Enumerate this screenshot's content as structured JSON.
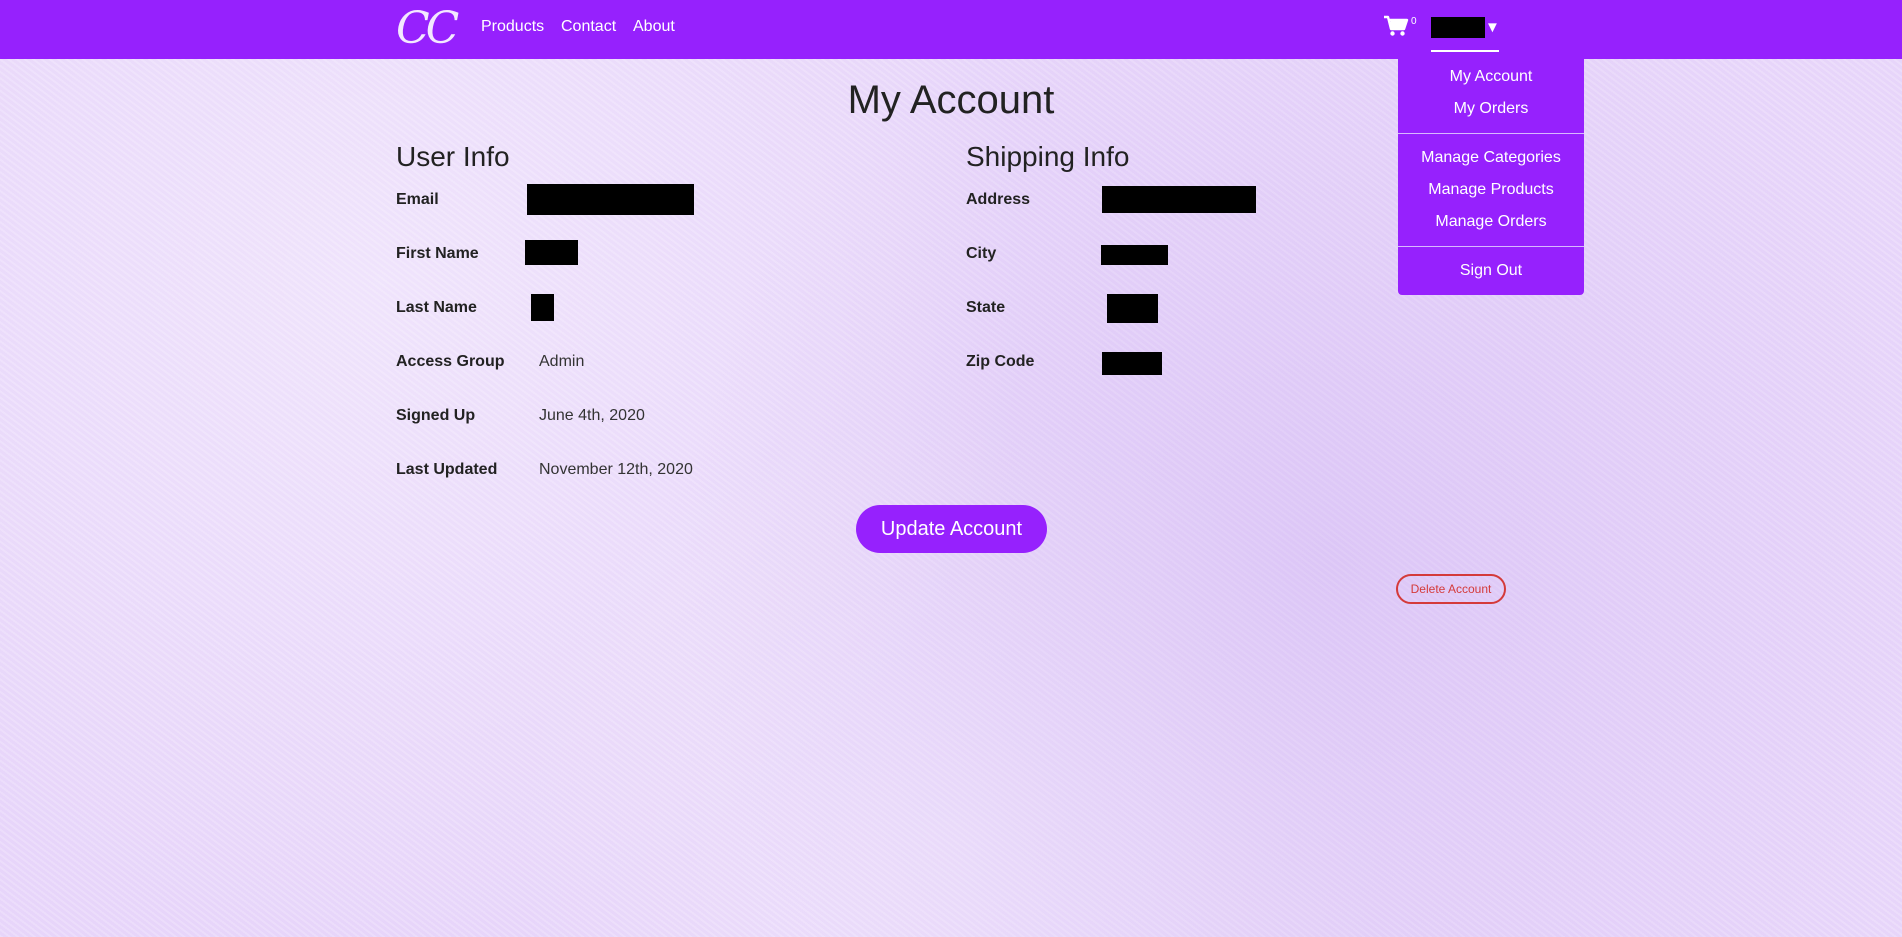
{
  "brand": {
    "logo_text": "CC"
  },
  "nav": {
    "links": [
      "Products",
      "Contact",
      "About"
    ],
    "cart_count": "0"
  },
  "dropdown": {
    "items": [
      "My Account",
      "My Orders",
      "Manage Categories",
      "Manage Products",
      "Manage Orders",
      "Sign Out"
    ]
  },
  "page": {
    "title": "My Account"
  },
  "user_info": {
    "title": "User Info",
    "email_label": "Email",
    "first_name_label": "First Name",
    "last_name_label": "Last Name",
    "access_group_label": "Access Group",
    "access_group_value": "Admin",
    "signed_up_label": "Signed Up",
    "signed_up_value": "June 4th, 2020",
    "last_updated_label": "Last Updated",
    "last_updated_value": "November 12th, 2020"
  },
  "shipping_info": {
    "title": "Shipping Info",
    "address_label": "Address",
    "city_label": "City",
    "state_label": "State",
    "zip_label": "Zip Code"
  },
  "actions": {
    "update_label": "Update Account",
    "delete_label": "Delete Account"
  },
  "colors": {
    "brand_purple": "#9621fd",
    "page_background": "#ead9fb",
    "danger": "#d43a3a"
  }
}
